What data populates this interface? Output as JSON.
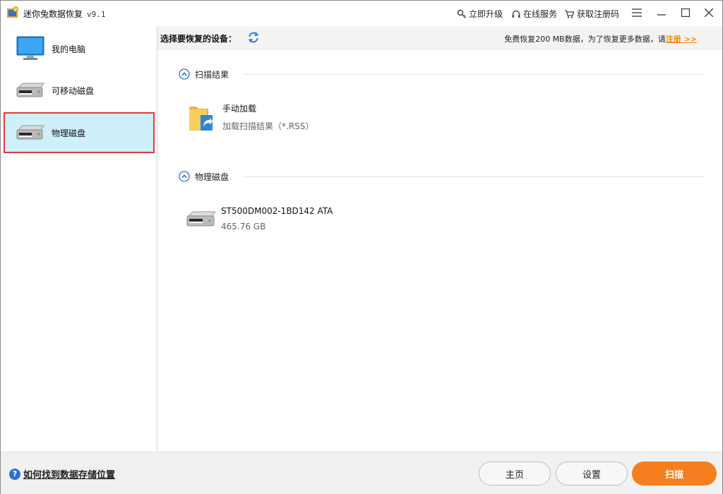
{
  "titlebar": {
    "title": "迷你兔数据恢复",
    "version": "v9.1",
    "links": {
      "upgrade": "立即升级",
      "service": "在线服务",
      "register_code": "获取注册码"
    }
  },
  "sidebar": {
    "items": [
      {
        "label": "我的电脑",
        "icon": "monitor-icon"
      },
      {
        "label": "可移动磁盘",
        "icon": "drive-icon"
      },
      {
        "label": "物理磁盘",
        "icon": "drive-icon",
        "selected": true
      }
    ]
  },
  "main": {
    "device_label": "选择要恢复的设备：",
    "free_note": "免费恢复200 MB数据，为了恢复更多数据，请",
    "register_link": "注册 >>",
    "sections": [
      {
        "title": "扫描结果",
        "entries": [
          {
            "name": "手动加载",
            "sub": "加载扫描结果（*.RSS）",
            "icon": "folder-load-icon"
          }
        ]
      },
      {
        "title": "物理磁盘",
        "entries": [
          {
            "name": "ST500DM002-1BD142 ATA",
            "sub": "465.76 GB",
            "icon": "hard-drive-icon"
          }
        ]
      }
    ]
  },
  "footer": {
    "help_text": "如何找到数据存储位置",
    "buttons": {
      "home": "主页",
      "settings": "设置",
      "scan": "扫描"
    }
  },
  "colors": {
    "accent": "#f57f1f",
    "selected_bg": "#cdf0fa",
    "selection_border": "#e03a3a",
    "refresh": "#2f7fd8",
    "link": "#f08a00"
  }
}
